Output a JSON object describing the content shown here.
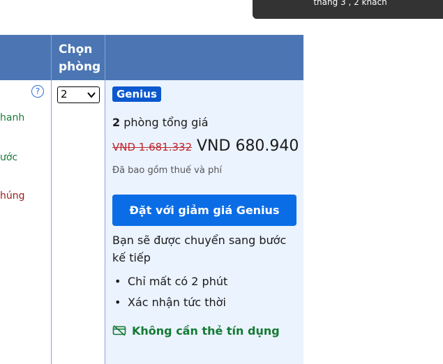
{
  "tooltip": {
    "text": "tháng 3 , 2 khách"
  },
  "table": {
    "header": {
      "choose_room": "Chọn phòng"
    },
    "left_column": {
      "line1": "hanh",
      "line2": "ước",
      "line3": "húng"
    },
    "room_select": {
      "value": "2"
    },
    "genius_badge": "Genius",
    "price": {
      "rooms_count": "2",
      "rooms_label": "phòng tổng giá",
      "old_price": "VND 1.681.332",
      "new_price": "VND 680.940",
      "tax_note": "Đã bao gồm thuế và phí"
    },
    "book_button": "Đặt với giảm giá Genius",
    "redirect_note": "Bạn sẽ được chuyển sang bước kế tiếp",
    "bullets": [
      "Chỉ mất có 2 phút",
      "Xác nhận tức thời"
    ],
    "no_card": "Không cần thẻ tín dụng"
  },
  "colors": {
    "header_blue": "#4b76b3",
    "panel_bg": "#ebf3ff",
    "button_blue": "#0b6de6",
    "genius_blue": "#0b58cf",
    "strike_red": "#c0262c",
    "success_green": "#137a32"
  },
  "icons": {
    "help": "question-circle-icon",
    "dropdown": "chevron-down-icon",
    "no_card": "card-off-icon"
  }
}
